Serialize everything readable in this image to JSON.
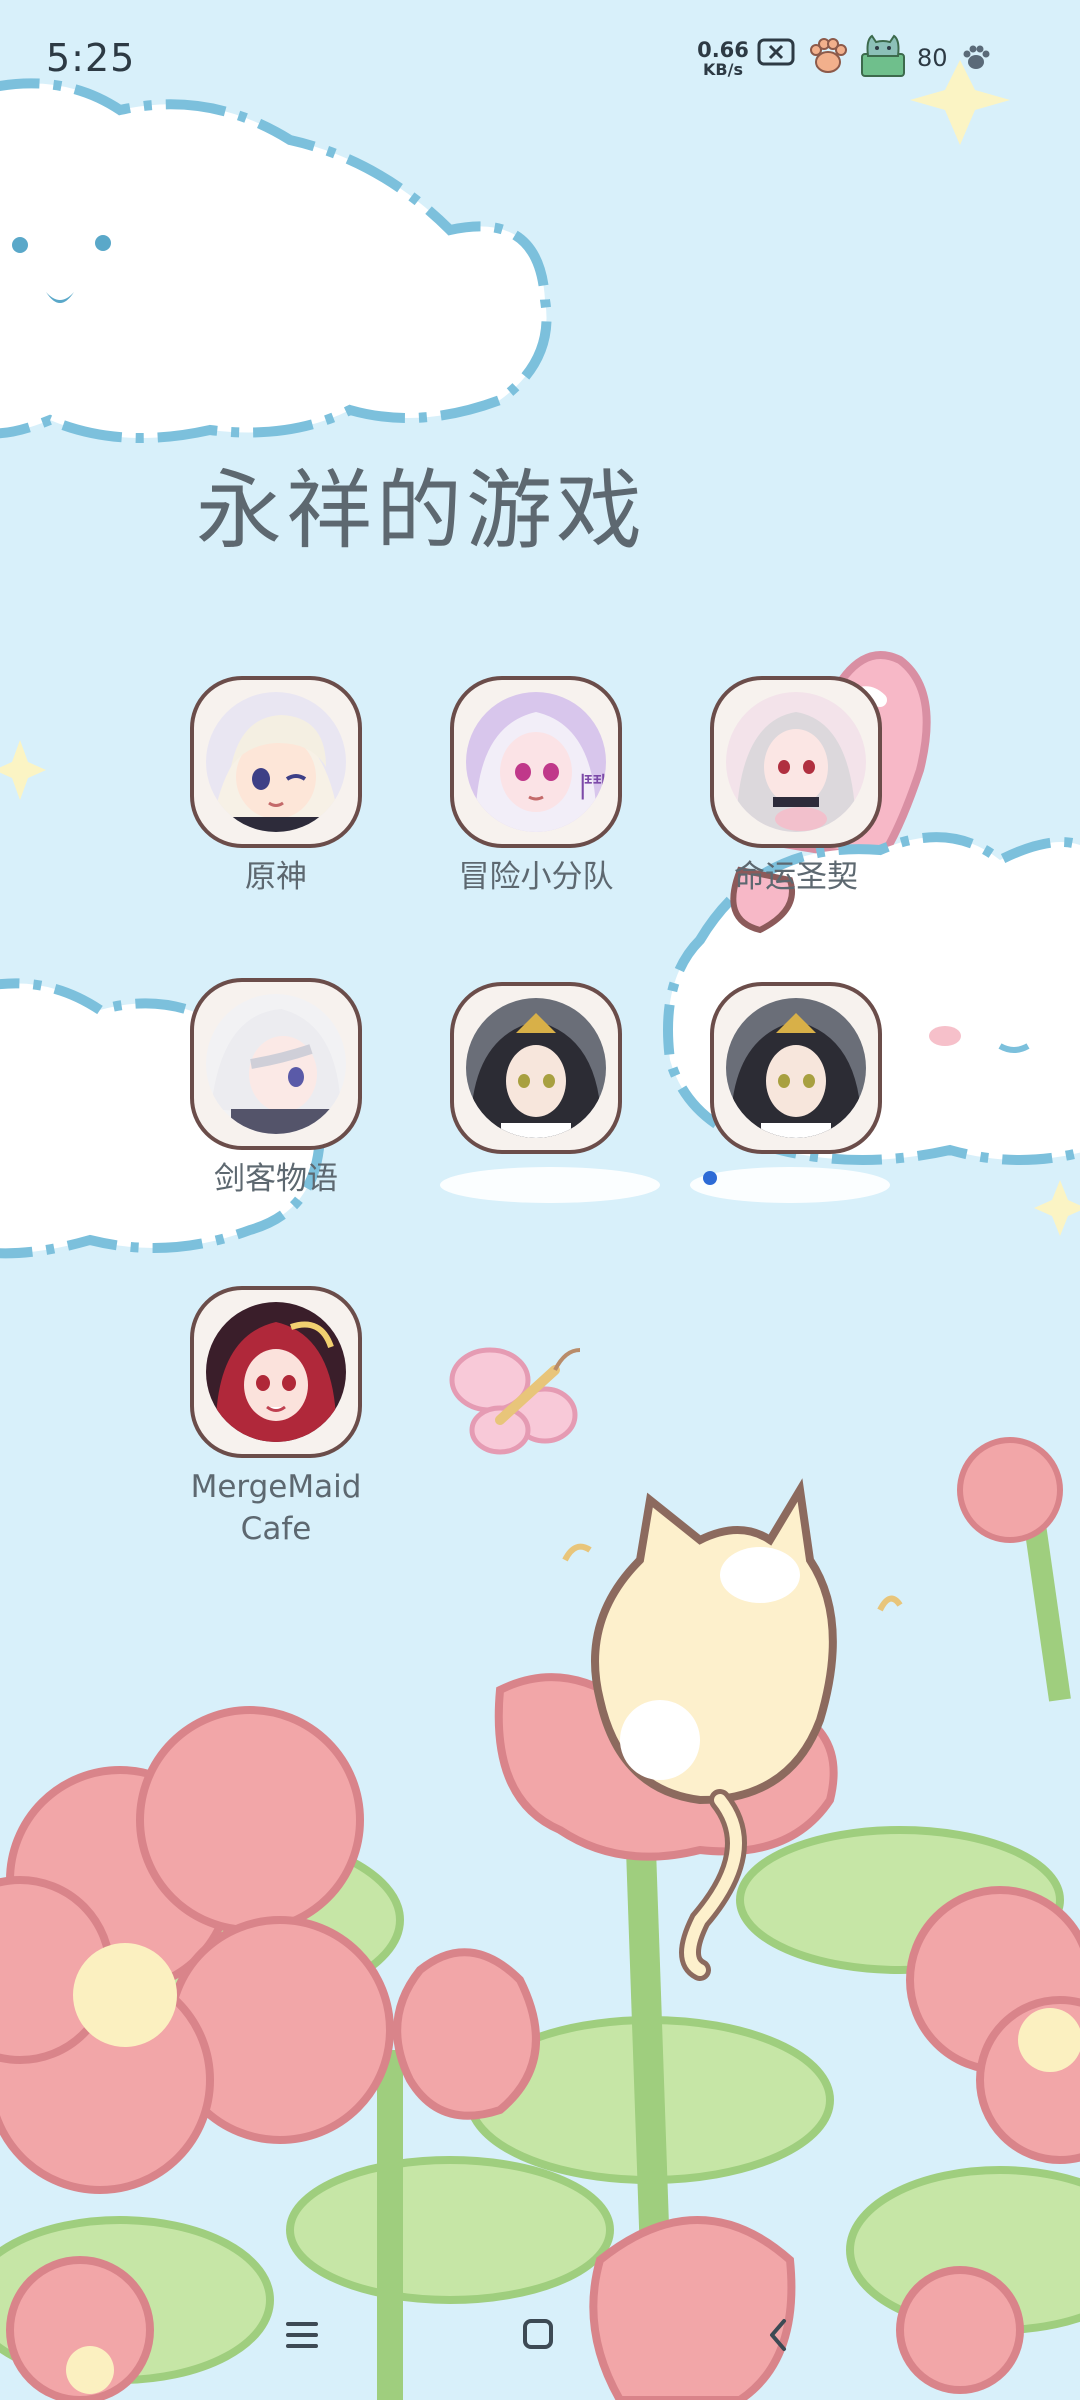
{
  "status_bar": {
    "time": "5:25",
    "net_speed_value": "0.66",
    "net_speed_unit": "KB/s",
    "battery_level": "80",
    "icons": [
      "sim-x-icon",
      "paw-icon",
      "cat-icon",
      "paw-small-icon"
    ]
  },
  "folder": {
    "title": "永祥的游戏"
  },
  "apps": [
    {
      "label": "原神",
      "icon": "genshin-app-icon"
    },
    {
      "label": "冒险小分队",
      "icon": "adventure-squad-app-icon"
    },
    {
      "label": "命运圣契",
      "icon": "destiny-covenant-app-icon"
    },
    {
      "label": "剑客物语",
      "icon": "swordsman-tale-app-icon"
    },
    {
      "label": "",
      "icon": "unnamed-game-app-icon"
    },
    {
      "label": "",
      "icon": "unnamed-game-app-icon"
    },
    {
      "label": "MergeMaid Cafe",
      "icon": "mergemaid-cafe-app-icon"
    }
  ],
  "navigation": {
    "buttons": [
      "menu-icon",
      "home-icon",
      "back-icon"
    ]
  },
  "colors": {
    "sky": "#d8f0fa",
    "cloud_outline": "#7cc0dc",
    "flower_pink": "#f2a6a8",
    "leaf_green": "#bde3a0",
    "icon_border": "#6b4d4a",
    "text": "#5d6870"
  }
}
